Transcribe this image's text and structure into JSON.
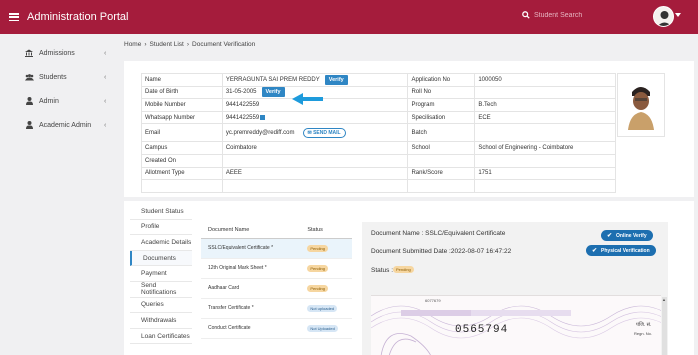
{
  "app": {
    "title": "Administration Portal",
    "search_placeholder": "Student Search"
  },
  "sidebar": {
    "items": [
      {
        "label": "Admissions",
        "icon": "bank-icon"
      },
      {
        "label": "Students",
        "icon": "users-icon"
      },
      {
        "label": "Admin",
        "icon": "user-icon"
      },
      {
        "label": "Academic Admin",
        "icon": "user-icon"
      }
    ]
  },
  "breadcrumb": [
    "Home",
    "›",
    "Student List",
    "›",
    "Document Verification"
  ],
  "student": {
    "name_label": "Name",
    "name": "YERRAGUNTA SAI PREM REDDY",
    "dob_label": "Date of Birth",
    "dob": "31-05-2005",
    "mobile_label": "Mobile Number",
    "mobile": "9441422559",
    "whatsapp_label": "Whatsapp Number",
    "whatsapp": "9441422559",
    "email_label": "Email",
    "email": "yc.premreddy@rediff.com",
    "campus_label": "Campus",
    "campus": "Coimbatore",
    "created_label": "Created On",
    "created": "",
    "allotment_label": "Allotment Type",
    "allotment": "AEEE",
    "app_no_label": "Application No",
    "app_no": "1000050",
    "roll_label": "Roll No",
    "roll": "",
    "program_label": "Program",
    "program": "B.Tech",
    "spec_label": "Specilisation",
    "spec": "ECE",
    "batch_label": "Batch",
    "batch": "",
    "school_label": "School",
    "school": "School of Engineering - Coimbatore",
    "rank_label": "Rank/Score",
    "rank": "1751",
    "verify_label": "Verify",
    "send_mail_label": "SEND MAIL"
  },
  "tabs": [
    "Student Status",
    "Profile",
    "Academic Details",
    "Documents",
    "Payment",
    "Send Notifications",
    "Queries",
    "Withdrawals",
    "Loan Certificates"
  ],
  "documents": {
    "headers": [
      "Document Name",
      "Status"
    ],
    "rows": [
      {
        "name": "SSLC/Equivalent Certificate *",
        "status": "Pending"
      },
      {
        "name": "12th Original Mark Sheet *",
        "status": "Pending"
      },
      {
        "name": "Aadhaar Card",
        "status": "Pending"
      },
      {
        "name": "Transfer Certificate *",
        "status": "Not uploaded"
      },
      {
        "name": "Conduct Certificate",
        "status": "Not Uploaded"
      }
    ]
  },
  "doc_detail": {
    "name_text": "Document Name : SSLC/Equivalent Certificate",
    "date_text": "Document Submitted Date :2022-08-07 16:47:22",
    "status_label": "Status :",
    "status": "Pending",
    "online_verify": "Online Verify",
    "physical_verify": "Physical Verification",
    "doc_number": "0565794",
    "top_number": "6077679",
    "corner_text": "पंजि. सं.",
    "corner_text2": "Regn. No."
  },
  "colors": {
    "brand": "#a51c3c",
    "accent": "#2f86c4",
    "pending": "#f6d6a0"
  }
}
